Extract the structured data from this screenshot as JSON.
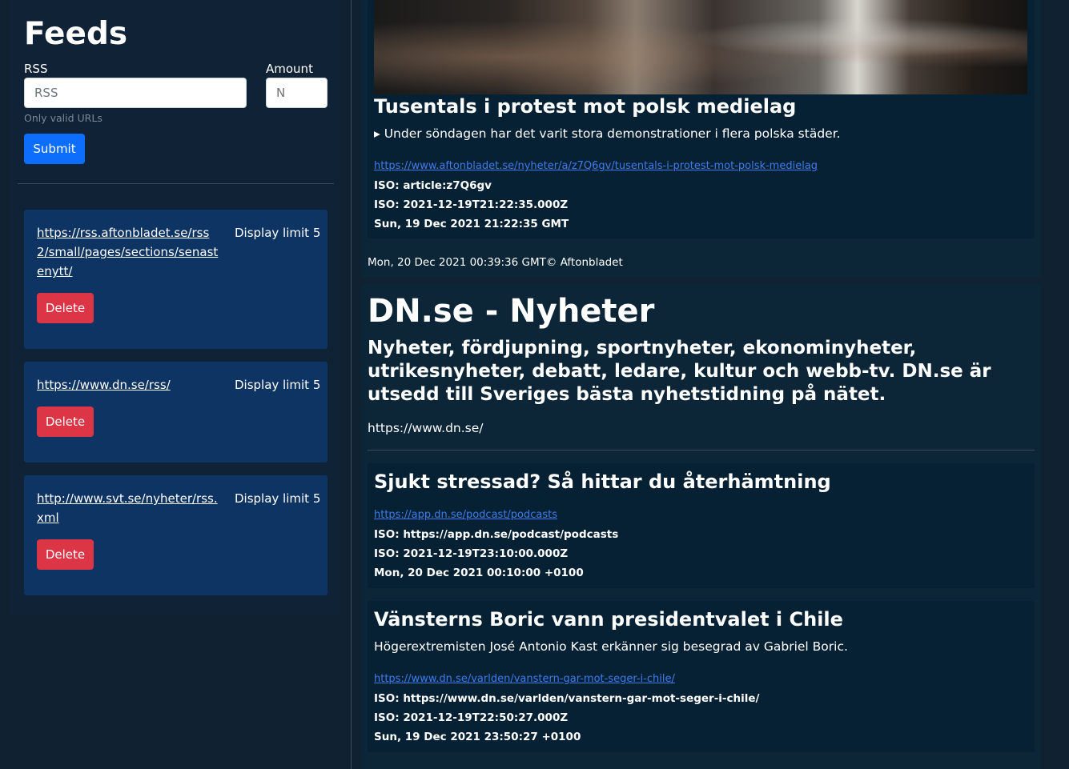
{
  "sidebar": {
    "title": "Feeds",
    "form": {
      "rss_label": "RSS",
      "rss_placeholder": "RSS",
      "amount_label": "Amount",
      "amount_placeholder": "N",
      "help_text": "Only valid URLs",
      "submit_label": "Submit"
    },
    "feeds": [
      {
        "url": "https://rss.aftonbladet.se/rss2/small/pages/sections/senastenytt/",
        "limit": "Display limit 5",
        "delete_label": "Delete"
      },
      {
        "url": "https://www.dn.se/rss/",
        "limit": "Display limit 5",
        "delete_label": "Delete"
      },
      {
        "url": "http://www.svt.se/nyheter/rss.xml",
        "limit": "Display limit 5",
        "delete_label": "Delete"
      }
    ]
  },
  "main": {
    "aftonbladet": {
      "item": {
        "title": "Tusentals i protest mot polsk medielag",
        "description": "▸ Under söndagen har det varit stora demonstrationer i flera polska städer.",
        "link": "https://www.aftonbladet.se/nyheter/a/z7Q6gv/tusentals-i-protest-mot-polsk-medielag",
        "iso_guid": "ISO: article:z7Q6gv",
        "iso_date": "ISO: 2021-12-19T21:22:35.000Z",
        "pub_date": "Sun, 19 Dec 2021 21:22:35 GMT"
      },
      "footer": "Mon, 20 Dec 2021 00:39:36 GMT© Aftonbladet"
    },
    "dn": {
      "title": "DN.se - Nyheter",
      "description": "Nyheter, fördjupning, sportnyheter, ekonominyheter, utrikesnyheter, debatt, ledare, kultur och webb-tv. DN.se är utsedd till Sveriges bästa nyhetstidning på nätet.",
      "url": "https://www.dn.se/",
      "items": [
        {
          "title": "Sjukt stressad? Så hittar du återhämtning",
          "link": "https://app.dn.se/podcast/podcasts",
          "iso_guid": "ISO: https://app.dn.se/podcast/podcasts",
          "iso_date": "ISO: 2021-12-19T23:10:00.000Z",
          "pub_date": "Mon, 20 Dec 2021 00:10:00 +0100"
        },
        {
          "title": "Vänsterns Boric vann presidentvalet i Chile",
          "description": "Högerextremisten José Antonio Kast erkänner sig besegrad av Gabriel Boric.",
          "link": "https://www.dn.se/varlden/vanstern-gar-mot-seger-i-chile/",
          "iso_guid": "ISO: https://www.dn.se/varlden/vanstern-gar-mot-seger-i-chile/",
          "iso_date": "ISO: 2021-12-19T22:50:27.000Z",
          "pub_date": "Sun, 19 Dec 2021 23:50:27 +0100"
        }
      ]
    }
  }
}
